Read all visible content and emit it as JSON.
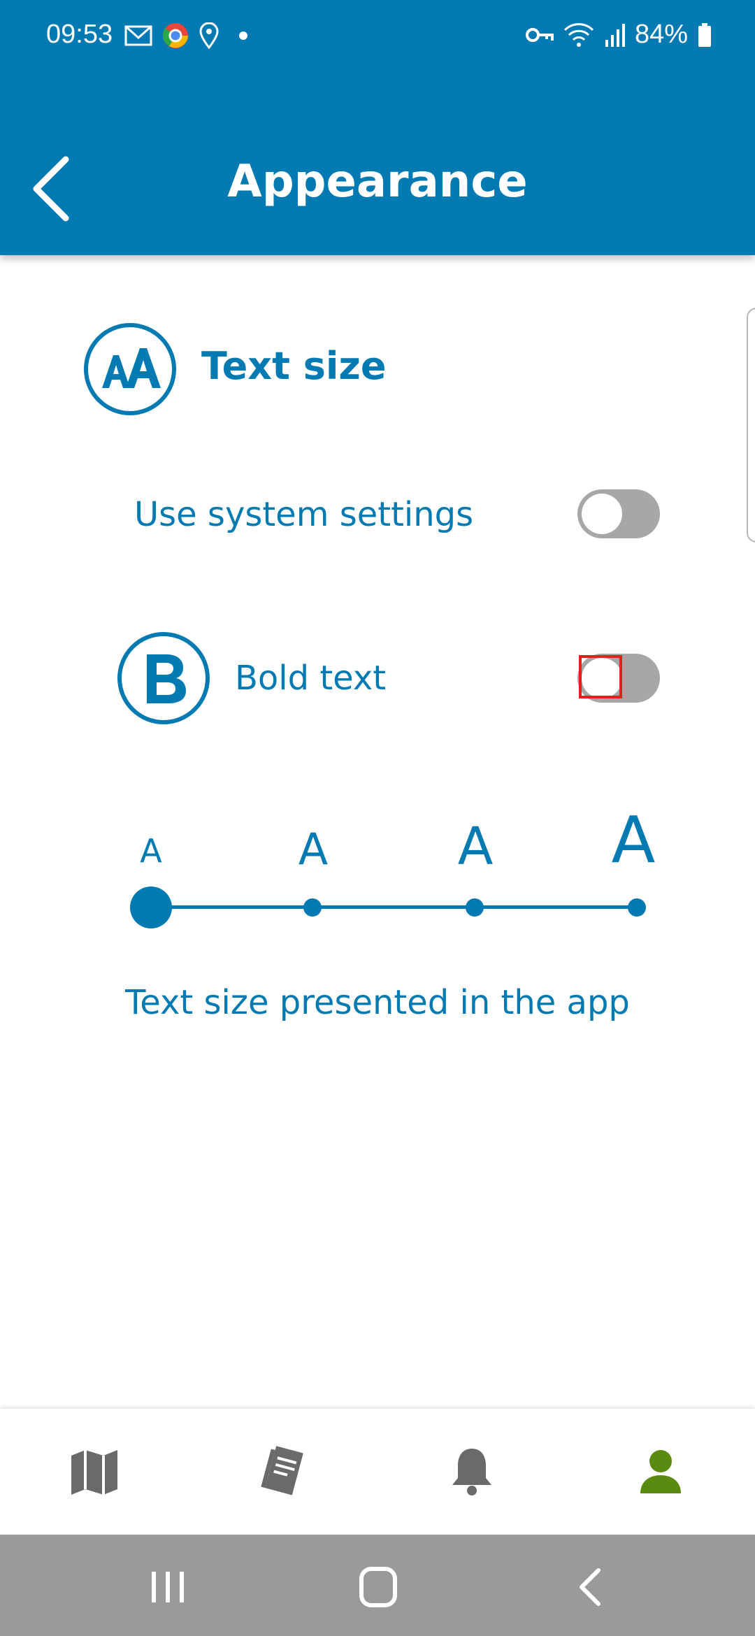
{
  "status_bar": {
    "time": "09:53",
    "battery": "84%",
    "left_icons": [
      "mail-icon",
      "chrome-icon",
      "location-icon",
      "dot-icon"
    ],
    "right_icons": [
      "vpn-key-icon",
      "wifi-icon",
      "signal-icon",
      "battery-icon"
    ]
  },
  "app_bar": {
    "title": "Appearance",
    "back_icon": "chevron-left-icon"
  },
  "text_size": {
    "title": "Text size",
    "icon": "text-size-icon",
    "use_system_label": "Use system settings",
    "use_system_on": false,
    "bold_label": "Bold text",
    "bold_icon": "bold-icon",
    "bold_on": false,
    "slider_labels": [
      "A",
      "A",
      "A",
      "A"
    ],
    "slider_selected_index": 0,
    "caption": "Text size presented in the app"
  },
  "bottom_nav": {
    "items": [
      {
        "icon": "map-icon",
        "active": false
      },
      {
        "icon": "tickets-icon",
        "active": false
      },
      {
        "icon": "bell-icon",
        "active": false
      },
      {
        "icon": "person-icon",
        "active": true
      }
    ]
  },
  "colors": {
    "primary": "#037ab2",
    "active_nav": "#5a8a0f",
    "inactive_nav": "#6a6a6a",
    "toggle_off": "#a7a7a9",
    "system_nav": "#9a9a9a"
  }
}
